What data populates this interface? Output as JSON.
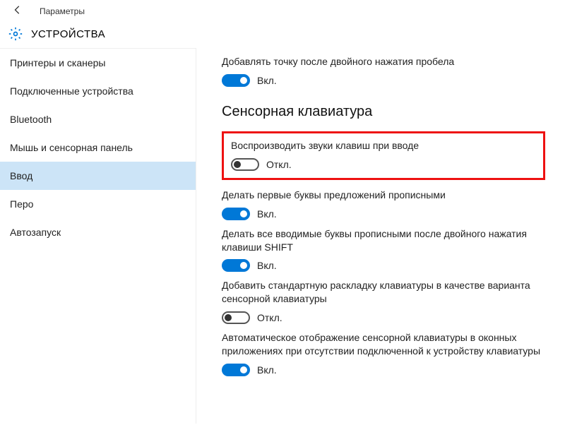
{
  "titlebar": {
    "title": "Параметры"
  },
  "header": {
    "title": "УСТРОЙСТВА"
  },
  "sidebar": {
    "items": [
      {
        "label": "Принтеры и сканеры"
      },
      {
        "label": "Подключенные устройства"
      },
      {
        "label": "Bluetooth"
      },
      {
        "label": "Мышь и сенсорная панель"
      },
      {
        "label": "Ввод"
      },
      {
        "label": "Перо"
      },
      {
        "label": "Автозапуск"
      }
    ]
  },
  "content": {
    "top_setting": {
      "label": "Добавлять точку после двойного нажатия пробела",
      "state": "Вкл."
    },
    "section_heading": "Сенсорная клавиатура",
    "settings": [
      {
        "label": "Воспроизводить звуки клавиш при вводе",
        "state": "Откл.",
        "on": false,
        "highlight": true
      },
      {
        "label": "Делать первые буквы предложений прописными",
        "state": "Вкл.",
        "on": true
      },
      {
        "label": "Делать все вводимые буквы прописными после двойного нажатия клавиши SHIFT",
        "state": "Вкл.",
        "on": true
      },
      {
        "label": "Добавить стандартную раскладку клавиатуры в качестве варианта сенсорной клавиатуры",
        "state": "Откл.",
        "on": false
      },
      {
        "label": "Автоматическое отображение сенсорной клавиатуры в оконных приложениях при отсутствии подключенной к устройству клавиатуры",
        "state": "Вкл.",
        "on": true
      }
    ]
  }
}
